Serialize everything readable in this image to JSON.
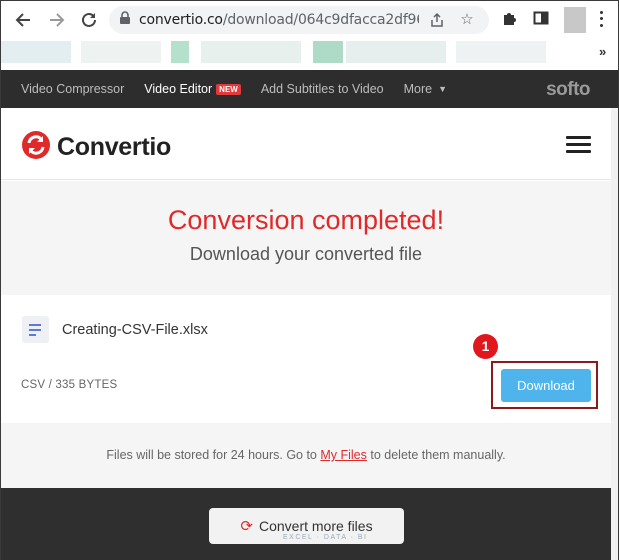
{
  "browser": {
    "url_main": "convertio.co",
    "url_path": "/download/064c9dfacca2df96..."
  },
  "site_nav": {
    "items": [
      {
        "label": "Video Compressor"
      },
      {
        "label": "Video Editor",
        "badge": "NEW"
      },
      {
        "label": "Add Subtitles to Video"
      },
      {
        "label": "More"
      }
    ],
    "brand": "softo"
  },
  "header": {
    "logo_text": "Convertio"
  },
  "hero": {
    "title": "Conversion completed!",
    "subtitle": "Download your converted file"
  },
  "file": {
    "name": "Creating-CSV-File.xlsx",
    "meta": "CSV / 335 BYTES",
    "download_label": "Download",
    "step_number": "1"
  },
  "note": {
    "text_before": "Files will be stored for 24 hours. Go to ",
    "link_text": "My Files",
    "text_after": " to delete them manually."
  },
  "footer": {
    "convert_more_label": "Convert more files",
    "watermark": "EXCEL · DATA · BI"
  },
  "colors": {
    "accent_red": "#e02a2a",
    "download_blue": "#4fb3ec",
    "nav_dark": "#2d2d2d"
  }
}
